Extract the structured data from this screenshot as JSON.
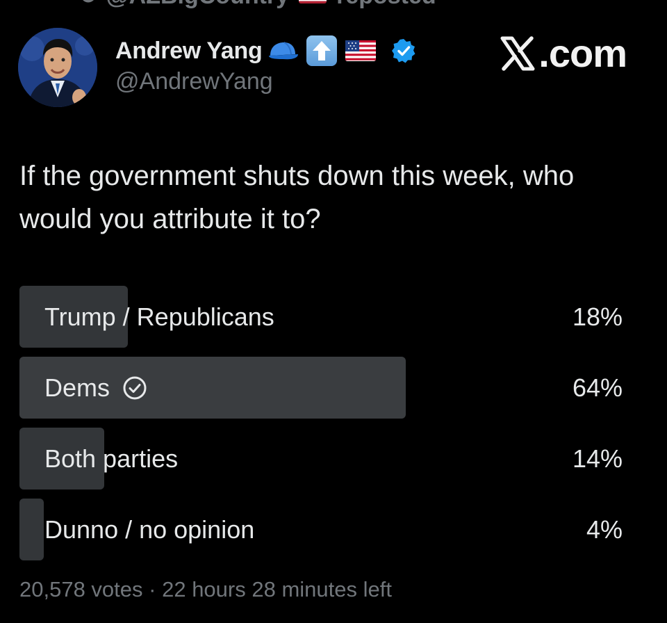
{
  "repost": {
    "text": "@AZBigCountry",
    "suffix": "reposted"
  },
  "author": {
    "display_name": "Andrew Yang",
    "handle": "@AndrewYang",
    "badges": [
      "blue-cap-emoji",
      "up-arrow-emoji",
      "us-flag-emoji",
      "verified-badge"
    ]
  },
  "brand": {
    "label": ".com"
  },
  "post": {
    "text": "If the government shuts down this week, who would you attribute it to?"
  },
  "poll": {
    "options": [
      {
        "label": "Trump / Republicans",
        "percent_text": "18%",
        "fraction": 0.18,
        "selected": false
      },
      {
        "label": "Dems",
        "percent_text": "64%",
        "fraction": 0.64,
        "selected": true
      },
      {
        "label": "Both parties",
        "percent_text": "14%",
        "fraction": 0.14,
        "selected": false
      },
      {
        "label": "Dunno / no opinion",
        "percent_text": "4%",
        "fraction": 0.04,
        "selected": false
      }
    ],
    "votes": "20,578 votes",
    "separator": " · ",
    "time_left": "22 hours 28 minutes left"
  },
  "colors": {
    "background": "#000000",
    "text": "#e7e9ea",
    "muted": "#71767b",
    "bar": "#333639",
    "verified": "#1d9bf0"
  }
}
